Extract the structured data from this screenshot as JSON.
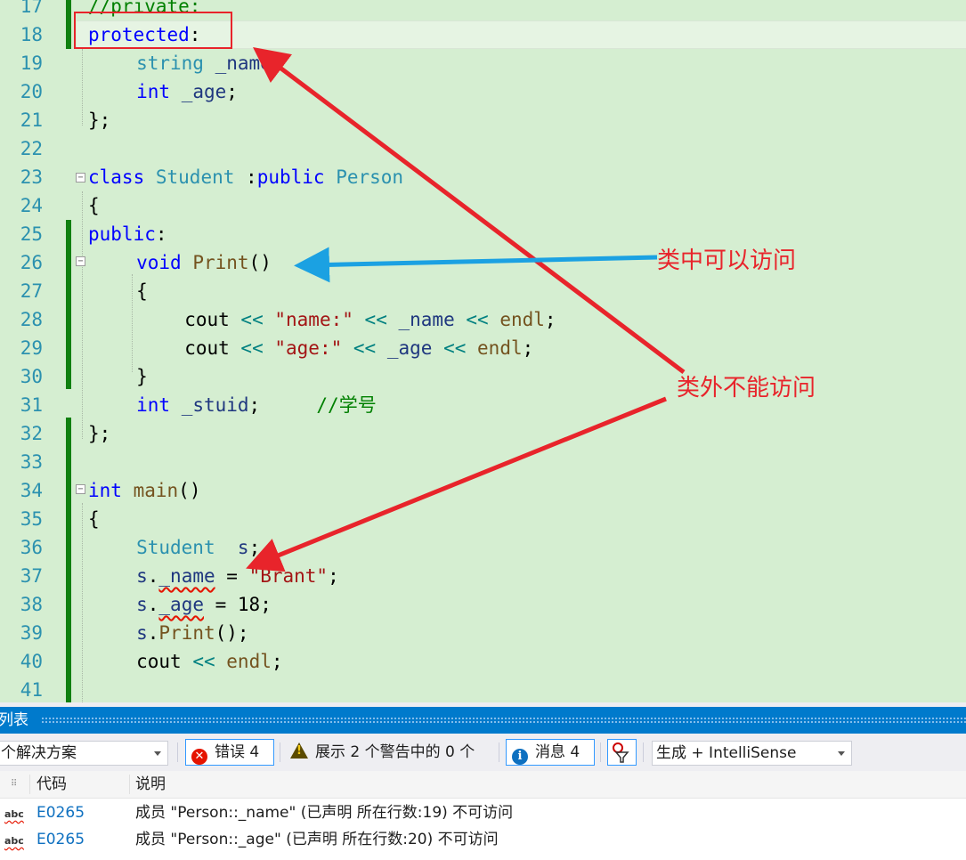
{
  "editor": {
    "lines": [
      {
        "n": "17",
        "indent": 0,
        "tokens": [
          {
            "t": "//private:",
            "c": "cm"
          }
        ]
      },
      {
        "n": "18",
        "indent": 0,
        "tokens": [
          {
            "t": "protected",
            "c": "kw"
          },
          {
            "t": ":",
            "c": ""
          }
        ]
      },
      {
        "n": "19",
        "indent": 2,
        "tokens": [
          {
            "t": "string",
            "c": "ty"
          },
          {
            "t": " ",
            "c": ""
          },
          {
            "t": "_name",
            "c": "id"
          },
          {
            "t": ";",
            "c": ""
          }
        ]
      },
      {
        "n": "20",
        "indent": 2,
        "tokens": [
          {
            "t": "int",
            "c": "kw"
          },
          {
            "t": " ",
            "c": ""
          },
          {
            "t": "_age",
            "c": "id"
          },
          {
            "t": ";",
            "c": ""
          }
        ]
      },
      {
        "n": "21",
        "indent": 0,
        "tokens": [
          {
            "t": "};",
            "c": ""
          }
        ]
      },
      {
        "n": "22",
        "indent": 0,
        "tokens": []
      },
      {
        "n": "23",
        "indent": 0,
        "tokens": [
          {
            "t": "class",
            "c": "kw"
          },
          {
            "t": " ",
            "c": ""
          },
          {
            "t": "Student",
            "c": "ty"
          },
          {
            "t": " :",
            "c": ""
          },
          {
            "t": "public",
            "c": "kw"
          },
          {
            "t": " ",
            "c": ""
          },
          {
            "t": "Person",
            "c": "ty"
          }
        ]
      },
      {
        "n": "24",
        "indent": 0,
        "tokens": [
          {
            "t": "{",
            "c": ""
          }
        ]
      },
      {
        "n": "25",
        "indent": 0,
        "tokens": [
          {
            "t": "public",
            "c": "kw"
          },
          {
            "t": ":",
            "c": ""
          }
        ]
      },
      {
        "n": "26",
        "indent": 2,
        "tokens": [
          {
            "t": "void",
            "c": "kw"
          },
          {
            "t": " ",
            "c": ""
          },
          {
            "t": "Print",
            "c": "fn"
          },
          {
            "t": "()",
            "c": ""
          }
        ]
      },
      {
        "n": "27",
        "indent": 2,
        "tokens": [
          {
            "t": "{",
            "c": ""
          }
        ]
      },
      {
        "n": "28",
        "indent": 4,
        "tokens": [
          {
            "t": "cout",
            "c": ""
          },
          {
            "t": " ",
            "c": ""
          },
          {
            "t": "<<",
            "c": "op"
          },
          {
            "t": " ",
            "c": ""
          },
          {
            "t": "\"name:\"",
            "c": "str"
          },
          {
            "t": " ",
            "c": ""
          },
          {
            "t": "<<",
            "c": "op"
          },
          {
            "t": " ",
            "c": ""
          },
          {
            "t": "_name",
            "c": "id"
          },
          {
            "t": " ",
            "c": ""
          },
          {
            "t": "<<",
            "c": "op"
          },
          {
            "t": " ",
            "c": ""
          },
          {
            "t": "endl",
            "c": "fn"
          },
          {
            "t": ";",
            "c": ""
          }
        ]
      },
      {
        "n": "29",
        "indent": 4,
        "tokens": [
          {
            "t": "cout",
            "c": ""
          },
          {
            "t": " ",
            "c": ""
          },
          {
            "t": "<<",
            "c": "op"
          },
          {
            "t": " ",
            "c": ""
          },
          {
            "t": "\"age:\"",
            "c": "str"
          },
          {
            "t": " ",
            "c": ""
          },
          {
            "t": "<<",
            "c": "op"
          },
          {
            "t": " ",
            "c": ""
          },
          {
            "t": "_age",
            "c": "id"
          },
          {
            "t": " ",
            "c": ""
          },
          {
            "t": "<<",
            "c": "op"
          },
          {
            "t": " ",
            "c": ""
          },
          {
            "t": "endl",
            "c": "fn"
          },
          {
            "t": ";",
            "c": ""
          }
        ]
      },
      {
        "n": "30",
        "indent": 2,
        "tokens": [
          {
            "t": "}",
            "c": ""
          }
        ]
      },
      {
        "n": "31",
        "indent": 2,
        "tokens": [
          {
            "t": "int",
            "c": "kw"
          },
          {
            "t": " ",
            "c": ""
          },
          {
            "t": "_stuid",
            "c": "id"
          },
          {
            "t": ";     ",
            "c": ""
          },
          {
            "t": "//学号",
            "c": "cm"
          }
        ]
      },
      {
        "n": "32",
        "indent": 0,
        "tokens": [
          {
            "t": "};",
            "c": ""
          }
        ]
      },
      {
        "n": "33",
        "indent": 0,
        "tokens": []
      },
      {
        "n": "34",
        "indent": 0,
        "tokens": [
          {
            "t": "int",
            "c": "kw"
          },
          {
            "t": " ",
            "c": ""
          },
          {
            "t": "main",
            "c": "fn"
          },
          {
            "t": "()",
            "c": ""
          }
        ]
      },
      {
        "n": "35",
        "indent": 0,
        "tokens": [
          {
            "t": "{",
            "c": ""
          }
        ]
      },
      {
        "n": "36",
        "indent": 2,
        "tokens": [
          {
            "t": "Student",
            "c": "ty"
          },
          {
            "t": "  ",
            "c": ""
          },
          {
            "t": "s",
            "c": "id"
          },
          {
            "t": ";",
            "c": ""
          }
        ]
      },
      {
        "n": "37",
        "indent": 2,
        "tokens": [
          {
            "t": "s",
            "c": "id"
          },
          {
            "t": ".",
            "c": ""
          },
          {
            "t": "_name",
            "c": "id sq"
          },
          {
            "t": " = ",
            "c": ""
          },
          {
            "t": "\"Brant\"",
            "c": "str"
          },
          {
            "t": ";",
            "c": ""
          }
        ]
      },
      {
        "n": "38",
        "indent": 2,
        "tokens": [
          {
            "t": "s",
            "c": "id"
          },
          {
            "t": ".",
            "c": ""
          },
          {
            "t": "_age",
            "c": "id sq"
          },
          {
            "t": " = 18;",
            "c": ""
          }
        ]
      },
      {
        "n": "39",
        "indent": 2,
        "tokens": [
          {
            "t": "s",
            "c": "id"
          },
          {
            "t": ".",
            "c": ""
          },
          {
            "t": "Print",
            "c": "fn"
          },
          {
            "t": "();",
            "c": ""
          }
        ]
      },
      {
        "n": "40",
        "indent": 2,
        "tokens": [
          {
            "t": "cout",
            "c": ""
          },
          {
            "t": " ",
            "c": ""
          },
          {
            "t": "<<",
            "c": "op"
          },
          {
            "t": " ",
            "c": ""
          },
          {
            "t": "endl",
            "c": "fn"
          },
          {
            "t": ";",
            "c": ""
          }
        ]
      },
      {
        "n": "41",
        "indent": 0,
        "tokens": []
      }
    ],
    "fold_marker": "−"
  },
  "annotations": {
    "inside_label": "类中可以访问",
    "outside_label": "类外不能访问"
  },
  "colors": {
    "editor_bg": "#d5eed1",
    "annotation_red": "#e8242b",
    "annotation_blue": "#1ba1e2",
    "title_bar": "#007acc"
  },
  "error_list": {
    "title": "列表",
    "scope_combo": "个解决方案",
    "errors_label": "错误 4",
    "warnings_label": "展示 2 个警告中的 0 个",
    "messages_label": "消息 4",
    "build_combo": "生成 + IntelliSense",
    "columns": {
      "code": "代码",
      "description": "说明"
    },
    "rows": [
      {
        "icon": "abc",
        "code": "E0265",
        "description": "成员 \"Person::_name\" (已声明 所在行数:19) 不可访问"
      },
      {
        "icon": "abc",
        "code": "E0265",
        "description": "成员 \"Person::_age\" (已声明 所在行数:20) 不可访问"
      }
    ]
  }
}
